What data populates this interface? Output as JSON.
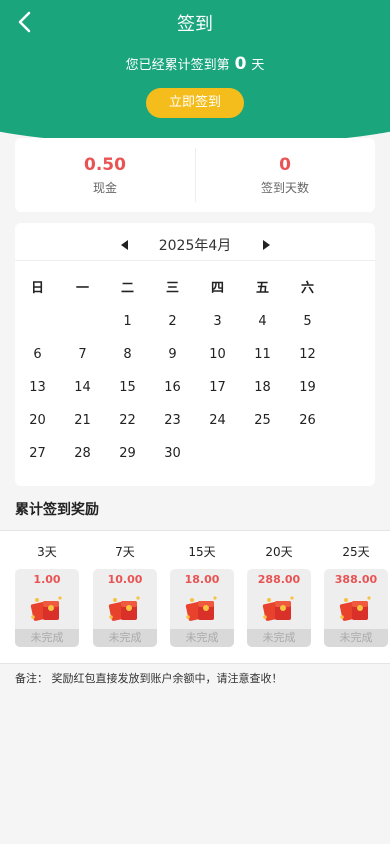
{
  "header": {
    "title": "签到",
    "sub_prefix": "您已经累计签到第",
    "days": "0",
    "sub_suffix": "天",
    "sign_button": "立即签到"
  },
  "stats": [
    {
      "value": "0.50",
      "label": "现金"
    },
    {
      "value": "0",
      "label": "签到天数"
    }
  ],
  "calendar": {
    "month": "2025年4月",
    "weekdays": [
      "日",
      "一",
      "二",
      "三",
      "四",
      "五",
      "六"
    ],
    "weeks": [
      [
        "",
        "",
        "1",
        "2",
        "3",
        "4",
        "5"
      ],
      [
        "6",
        "7",
        "8",
        "9",
        "10",
        "11",
        "12"
      ],
      [
        "13",
        "14",
        "15",
        "16",
        "17",
        "18",
        "19"
      ],
      [
        "20",
        "21",
        "22",
        "23",
        "24",
        "25",
        "26"
      ],
      [
        "27",
        "28",
        "29",
        "30",
        "",
        "",
        ""
      ]
    ]
  },
  "rewards_title": "累计签到奖励",
  "rewards": [
    {
      "days": "3天",
      "amount": "1.00",
      "status": "未完成"
    },
    {
      "days": "7天",
      "amount": "10.00",
      "status": "未完成"
    },
    {
      "days": "15天",
      "amount": "18.00",
      "status": "未完成"
    },
    {
      "days": "20天",
      "amount": "288.00",
      "status": "未完成"
    },
    {
      "days": "25天",
      "amount": "388.00",
      "status": "未完成"
    }
  ],
  "note": "备注：  奖励红包直接发放到账户余额中，请注意查收！",
  "colors": {
    "brand": "#1aa57d",
    "button": "#f5bd1c",
    "accent": "#e85454"
  }
}
